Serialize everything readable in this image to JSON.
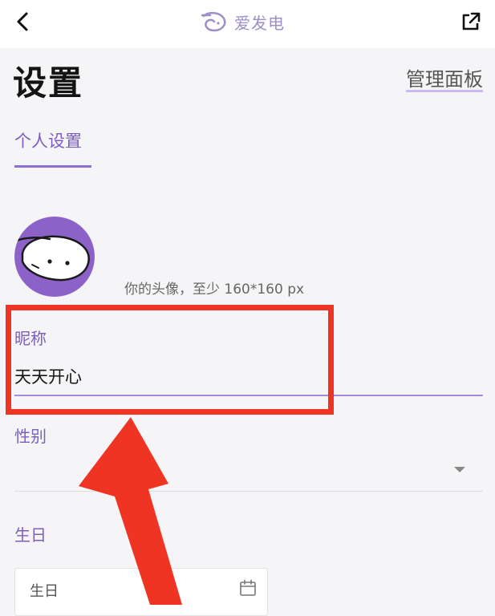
{
  "header": {
    "back_icon": "chevron-left-icon",
    "brand_name": "爱发电",
    "external_icon": "external-link-icon"
  },
  "page": {
    "title": "设置",
    "panel_link": "管理面板"
  },
  "tabs": [
    {
      "label": "个人设置",
      "active": true
    }
  ],
  "profile": {
    "avatar_hint": "你的头像，至少 160*160 px",
    "nickname_label": "昵称",
    "nickname_value": "天天开心",
    "gender_label": "性别",
    "gender_value": "",
    "birthday_label": "生日",
    "birthday_placeholder": "生日"
  },
  "colors": {
    "accent": "#7c5fbd",
    "highlight": "#ef3424"
  }
}
